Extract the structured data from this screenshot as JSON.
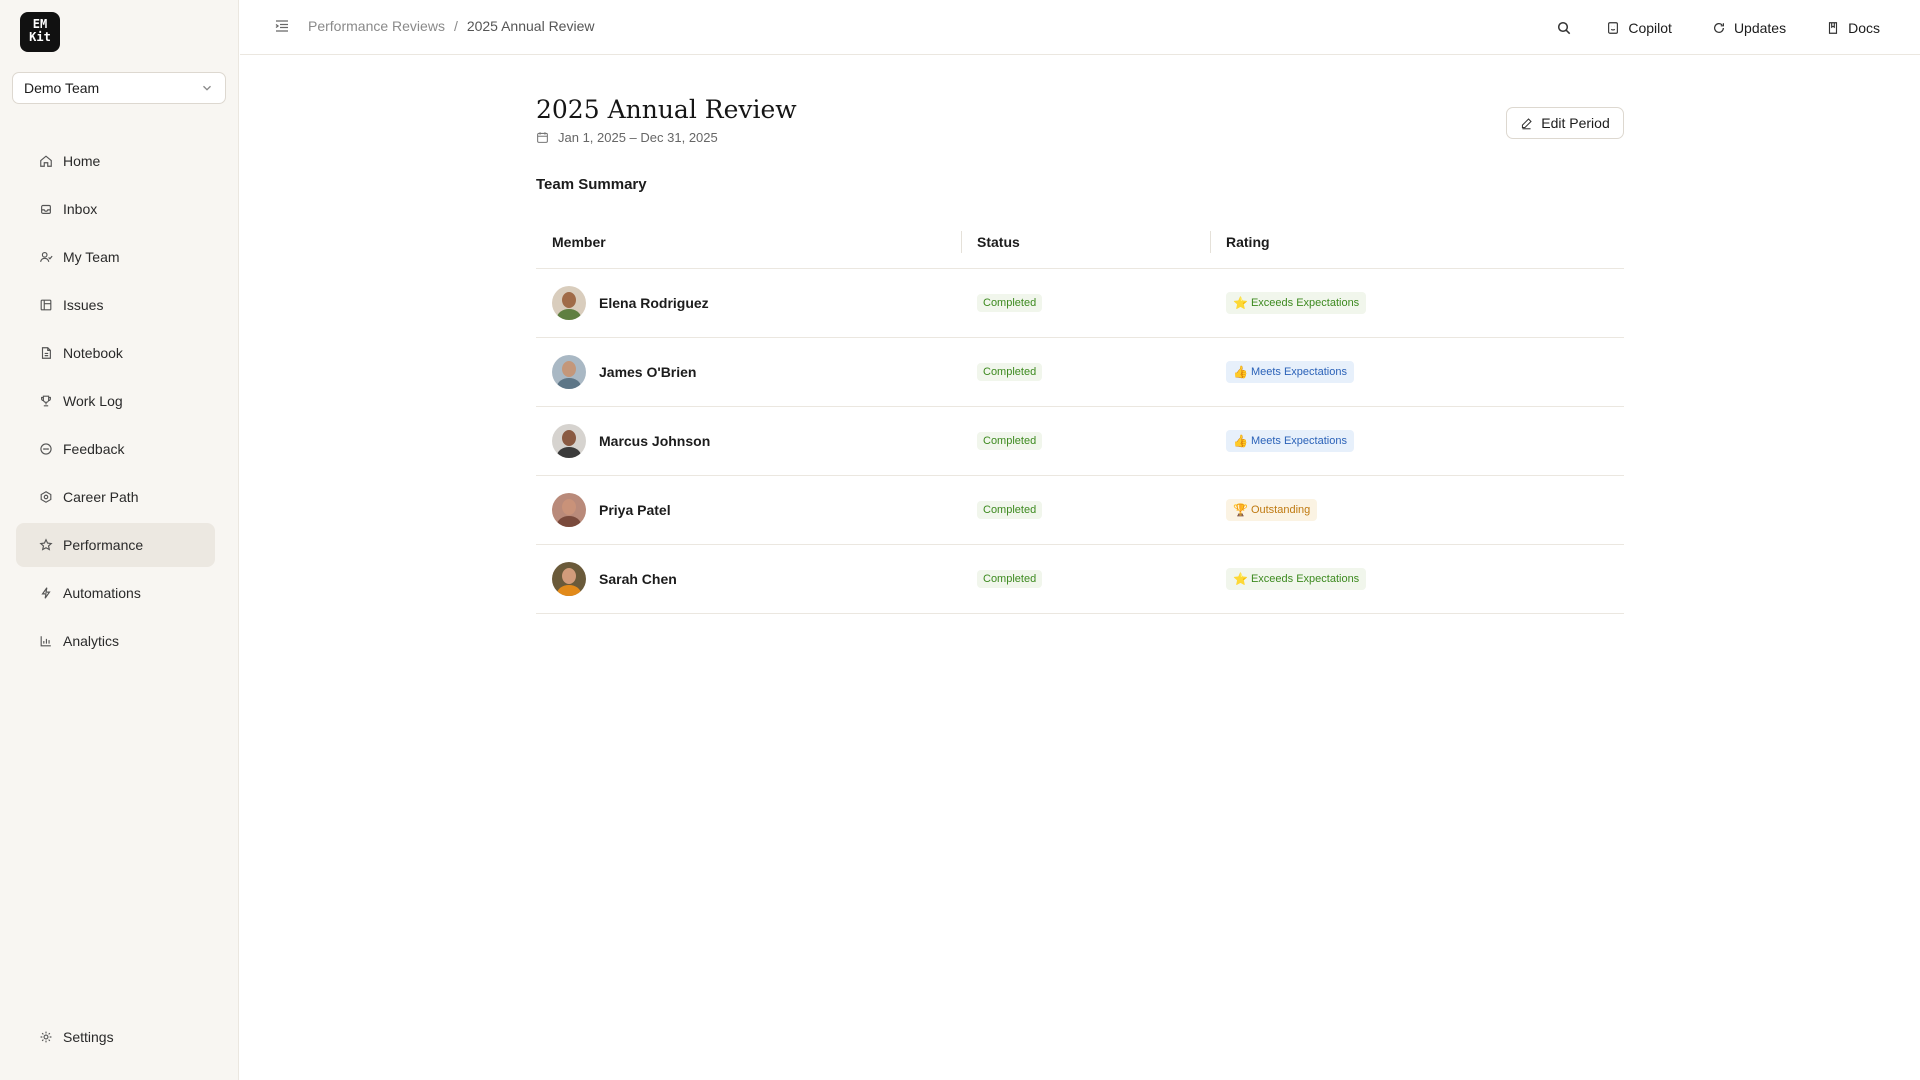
{
  "logo": {
    "line1": "EM",
    "line2": "Kit"
  },
  "team_select": {
    "value": "Demo Team"
  },
  "sidebar": {
    "items": [
      {
        "label": "Home",
        "icon": "home-icon"
      },
      {
        "label": "Inbox",
        "icon": "inbox-icon"
      },
      {
        "label": "My Team",
        "icon": "team-icon"
      },
      {
        "label": "Issues",
        "icon": "issues-icon"
      },
      {
        "label": "Notebook",
        "icon": "notebook-icon"
      },
      {
        "label": "Work Log",
        "icon": "trophy-icon"
      },
      {
        "label": "Feedback",
        "icon": "feedback-icon"
      },
      {
        "label": "Career Path",
        "icon": "career-icon"
      },
      {
        "label": "Performance",
        "icon": "star-icon",
        "active": true
      },
      {
        "label": "Automations",
        "icon": "bolt-icon"
      },
      {
        "label": "Analytics",
        "icon": "chart-icon"
      }
    ],
    "settings": {
      "label": "Settings",
      "icon": "gear-icon"
    }
  },
  "topbar": {
    "breadcrumb": {
      "parent": "Performance Reviews",
      "separator": "/",
      "current": "2025 Annual Review"
    },
    "actions": {
      "copilot": "Copilot",
      "updates": "Updates",
      "docs": "Docs"
    }
  },
  "main": {
    "title": "2025 Annual Review",
    "date_range": "Jan 1, 2025 – Dec 31, 2025",
    "edit_button": "Edit Period",
    "section_title": "Team Summary",
    "table": {
      "headers": {
        "member": "Member",
        "status": "Status",
        "rating": "Rating"
      },
      "rows": [
        {
          "name": "Elena Rodriguez",
          "status": "Completed",
          "rating": "Exceeds Expectations",
          "rating_emoji": "⭐",
          "rating_kind": "exceeds"
        },
        {
          "name": "James O'Brien",
          "status": "Completed",
          "rating": "Meets Expectations",
          "rating_emoji": "👍",
          "rating_kind": "meets"
        },
        {
          "name": "Marcus Johnson",
          "status": "Completed",
          "rating": "Meets Expectations",
          "rating_emoji": "👍",
          "rating_kind": "meets"
        },
        {
          "name": "Priya Patel",
          "status": "Completed",
          "rating": "Outstanding",
          "rating_emoji": "🏆",
          "rating_kind": "outstanding"
        },
        {
          "name": "Sarah Chen",
          "status": "Completed",
          "rating": "Exceeds Expectations",
          "rating_emoji": "⭐",
          "rating_kind": "exceeds"
        }
      ]
    }
  },
  "colors": {
    "sidebar_bg": "#f8f6f2",
    "active_nav_bg": "#ece8e1",
    "status_green": "#3d8a1f",
    "rating_blue": "#2b62b8",
    "rating_orange": "#bf7a12"
  }
}
